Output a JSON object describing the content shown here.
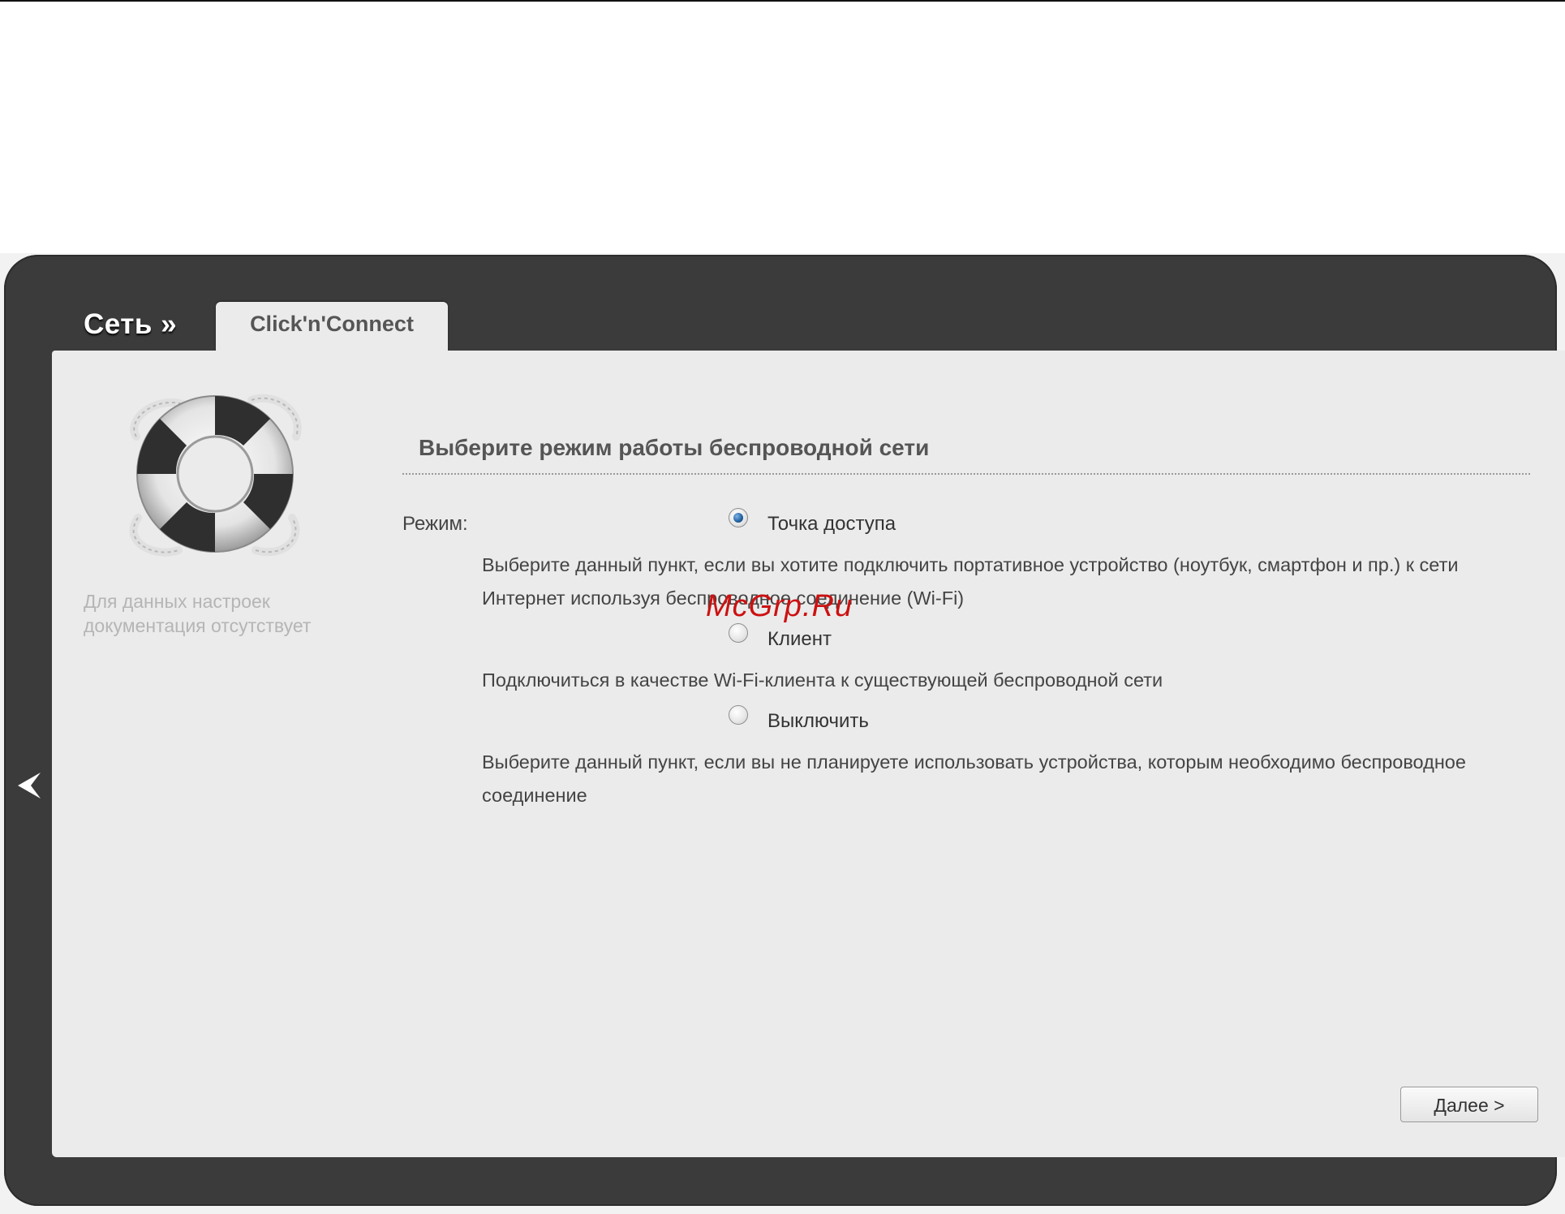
{
  "header": {
    "breadcrumb": "Сеть »",
    "tab_label": "Click'n'Connect"
  },
  "sidebar": {
    "help_text_line1": "Для данных настроек",
    "help_text_line2": "документация отсутствует",
    "icon": "lifebuoy-icon",
    "back_icon": "chevron-left-icon"
  },
  "main": {
    "title": "Выберите режим работы беспроводной сети",
    "mode_label": "Режим:",
    "options": [
      {
        "label": "Точка доступа",
        "selected": true,
        "description_line1": "Выберите данный пункт, если вы хотите подключить портативное устройство (ноутбук, смартфон и пр.) к сети",
        "description_line2": "Интернет используя беспроводное соединение (Wi-Fi)"
      },
      {
        "label": "Клиент",
        "selected": false,
        "description_line1": "Подключиться в качестве Wi-Fi-клиента к существующей беспроводной сети"
      },
      {
        "label": "Выключить",
        "selected": false,
        "description_line1": "Выберите данный пункт, если вы не планируете использовать устройства, которым необходимо беспроводное",
        "description_line2": "соединение"
      }
    ],
    "next_button": "Далее >"
  },
  "watermark": "McGrp.Ru",
  "colors": {
    "frame": "#3b3b3b",
    "panel": "#ebebeb",
    "radio_selected": "#1f5f9f",
    "watermark": "#cc1111"
  }
}
